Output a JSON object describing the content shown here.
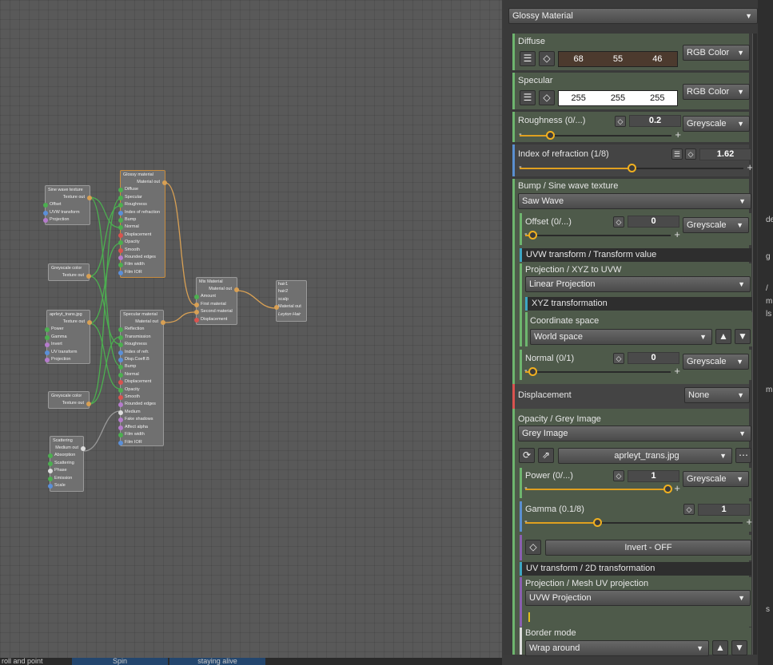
{
  "material_type": "Glossy Material",
  "colors": {
    "diffuse": "#4c3a2e",
    "specular": "#ffffff",
    "accent_slider": "#e0a020",
    "section_green": "#6eb56e",
    "section_blue": "#3da6c2",
    "section_red": "#d9534f"
  },
  "nodes": {
    "sine": {
      "title": "Sine wave texture",
      "out": "Texture out",
      "inputs": [
        "Offset",
        "UVW transform",
        "Projection"
      ]
    },
    "glossy": {
      "title": "Glossy material",
      "out": "Material out",
      "inputs": [
        "Diffuse",
        "Specular",
        "Roughness",
        "Index of refraction",
        "Bump",
        "Normal",
        "Displacement",
        "Opacity",
        "Smooth",
        "Rounded edges",
        "Film width",
        "Film IOR"
      ]
    },
    "grey1": {
      "title": "Greyscale color",
      "out": "Texture out"
    },
    "aprl": {
      "title": "aprleyt_trans.jpg",
      "out": "Texture out",
      "inputs": [
        "Power",
        "Gamma",
        "Invert",
        "UV transform",
        "Projection"
      ]
    },
    "grey2": {
      "title": "Greyscale color",
      "out": "Texture out"
    },
    "specular": {
      "title": "Specular material",
      "out": "Material out",
      "inputs": [
        "Reflection",
        "Transmission",
        "Roughness",
        "Index of refr.",
        "Disp.Coeff.B",
        "Bump",
        "Normal",
        "Displacement",
        "Opacity",
        "Smooth",
        "Rounded edges",
        "Medium",
        "Fake shadows",
        "Affect alpha",
        "Film width",
        "Film IOR"
      ]
    },
    "mix": {
      "title": "Mix Material",
      "out": "Material out",
      "inputs": [
        "Amount",
        "First material",
        "Second material",
        "Displacement"
      ]
    },
    "hair": {
      "lines": [
        "hair1",
        "hair2",
        "scalp"
      ],
      "out": "Material out",
      "name": "Leyton Hair"
    },
    "scatter": {
      "title": "Scattering",
      "out": "Medium out",
      "inputs": [
        "Absorption",
        "Scattering",
        "Phase",
        "Emission",
        "Scale"
      ]
    }
  },
  "bottom_tabs": [
    "roll and point",
    "Spin",
    "staying alive"
  ],
  "right_edge": [
    "de",
    "g",
    "/",
    "m",
    "ls",
    "m",
    "s"
  ],
  "panel": {
    "diffuse": {
      "label": "Diffuse",
      "r": "68",
      "g": "55",
      "b": "46",
      "mode": "RGB Color"
    },
    "specular": {
      "label": "Specular",
      "r": "255",
      "g": "255",
      "b": "255",
      "mode": "RGB Color"
    },
    "roughness": {
      "label": "Roughness (0/...)",
      "value": "0.2",
      "mode": "Greyscale",
      "level": 0.2
    },
    "ior": {
      "label": "Index of refraction (1/8)",
      "value": "1.62",
      "level": 0.5
    },
    "bump": {
      "label": "Bump / Sine wave texture",
      "type": "Saw Wave"
    },
    "offset": {
      "label": "Offset (0/...)",
      "value": "0",
      "mode": "Greyscale",
      "level": 0.05
    },
    "uvw": "UVW transform / Transform value",
    "projection": {
      "label": "Projection / XYZ to UVW",
      "value": "Linear Projection"
    },
    "xyz": "XYZ transformation",
    "coord": {
      "label": "Coordinate space",
      "value": "World space"
    },
    "normal": {
      "label": "Normal (0/1)",
      "value": "0",
      "mode": "Greyscale",
      "level": 0.05
    },
    "displacement": {
      "label": "Displacement",
      "value": "None"
    },
    "opacity": {
      "label": "Opacity / Grey Image",
      "value": "Grey Image"
    },
    "file": "aprleyt_trans.jpg",
    "power": {
      "label": "Power (0/...)",
      "value": "1",
      "mode": "Greyscale",
      "level": 0.98
    },
    "gamma": {
      "label": "Gamma (0.1/8)",
      "value": "1",
      "level": 0.33
    },
    "invert": "Invert - OFF",
    "uvt": "UV transform / 2D transformation",
    "projection2": {
      "label": "Projection / Mesh UV projection",
      "value": "UVW Projection"
    },
    "border": {
      "label": "Border mode",
      "value": "Wrap around"
    }
  }
}
